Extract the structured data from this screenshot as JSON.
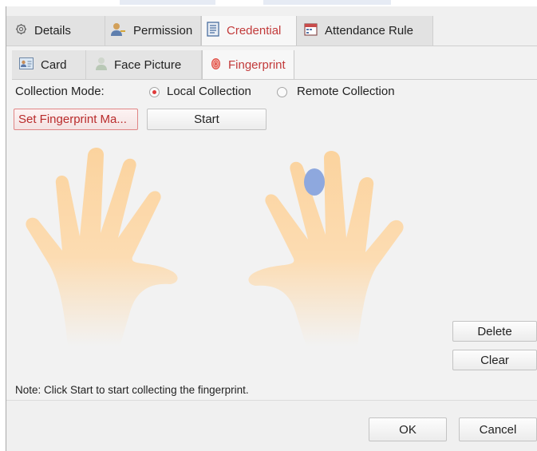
{
  "main_tabs": [
    {
      "label": "Details",
      "icon": "gear-icon"
    },
    {
      "label": "Permission",
      "icon": "user-key-icon"
    },
    {
      "label": "Credential",
      "icon": "document-icon"
    },
    {
      "label": "Attendance Rule",
      "icon": "calendar-icon"
    }
  ],
  "sub_tabs": [
    {
      "label": "Card",
      "icon": "card-icon"
    },
    {
      "label": "Face Picture",
      "icon": "person-icon"
    },
    {
      "label": "Fingerprint",
      "icon": "fingerprint-icon"
    }
  ],
  "collection": {
    "label": "Collection Mode:",
    "options": [
      {
        "label": "Local Collection",
        "checked": true
      },
      {
        "label": "Remote Collection",
        "checked": false
      }
    ]
  },
  "buttons": {
    "set_fingerprint": "Set Fingerprint Ma...",
    "start": "Start",
    "delete": "Delete",
    "clear": "Clear",
    "ok": "OK",
    "cancel": "Cancel"
  },
  "note": "Note: Click Start to start collecting the fingerprint.",
  "colors": {
    "accent": "#c23a3a",
    "hand": "#f9c98a",
    "selected_finger": "#8ea8de"
  }
}
